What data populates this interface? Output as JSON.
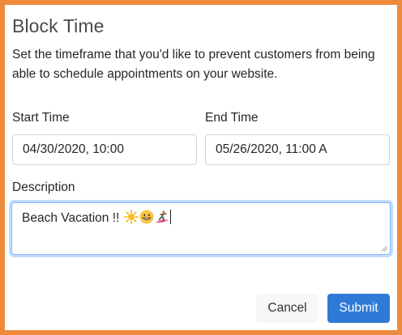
{
  "modal": {
    "title": "Block Time",
    "description": "Set the timeframe that you'd like to prevent customers from being able to schedule appointments on your website."
  },
  "form": {
    "start_label": "Start Time",
    "start_value": "04/30/2020, 10:00",
    "end_label": "End Time",
    "end_value": "05/26/2020, 11:00 A",
    "description_label": "Description",
    "description_value": "Beach Vacation !! "
  },
  "buttons": {
    "cancel": "Cancel",
    "submit": "Submit"
  },
  "colors": {
    "frame": "#ee8a3c",
    "primary": "#2f7ad6",
    "focus_border": "#86b7fe"
  },
  "icons": [
    "sun-icon",
    "grinning-face-icon",
    "surfer-icon"
  ]
}
